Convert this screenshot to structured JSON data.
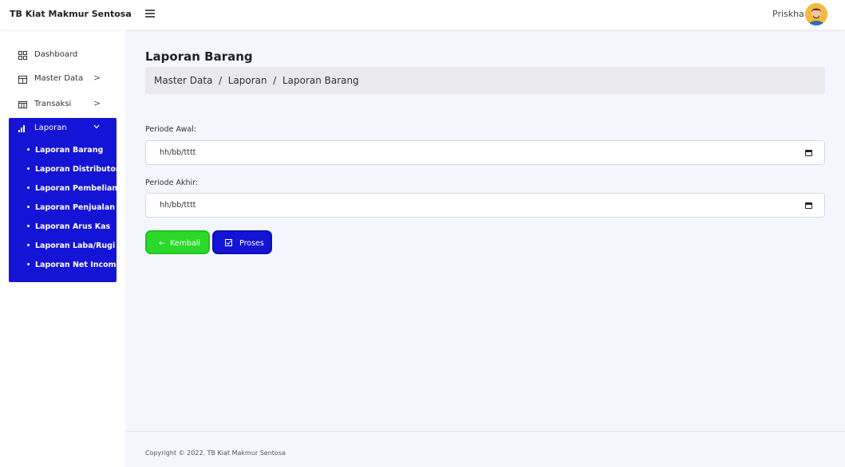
{
  "app": {
    "brand": "TB Kiat Makmur Sentosa",
    "user_name": "Priskha"
  },
  "sidebar": {
    "items": [
      {
        "label": "Dashboard",
        "icon": "grid-icon"
      },
      {
        "label": "Master Data",
        "icon": "table-icon",
        "chevron": ">"
      },
      {
        "label": "Transaksi",
        "icon": "columns-icon",
        "chevron": ">"
      }
    ],
    "laporan": {
      "label": "Laporan",
      "icon": "bar-chart-icon",
      "chevron": "v",
      "subitems": [
        "Laporan Barang",
        "Laporan Distributor",
        "Laporan Pembelian",
        "Laporan Penjualan",
        "Laporan Arus Kas",
        "Laporan Laba/Rugi",
        "Laporan Net Income"
      ]
    }
  },
  "main": {
    "title": "Laporan Barang",
    "breadcrumb": "Master Data  /  Laporan  /  Laporan Barang",
    "form": {
      "start_label": "Periode Awal:",
      "start_value": "hh/bb/tttt",
      "end_label": "Periode Akhir:",
      "end_value": "hh/bb/tttt"
    },
    "buttons": {
      "back": "Kembali",
      "process": "Proses"
    }
  },
  "footer": {
    "copyright": "Copyright © 2022. TB Kiat Makmur Sentosa"
  },
  "colors": {
    "primary": "#1414d6",
    "success": "#2bd92b",
    "background": "#f4f6fd"
  }
}
